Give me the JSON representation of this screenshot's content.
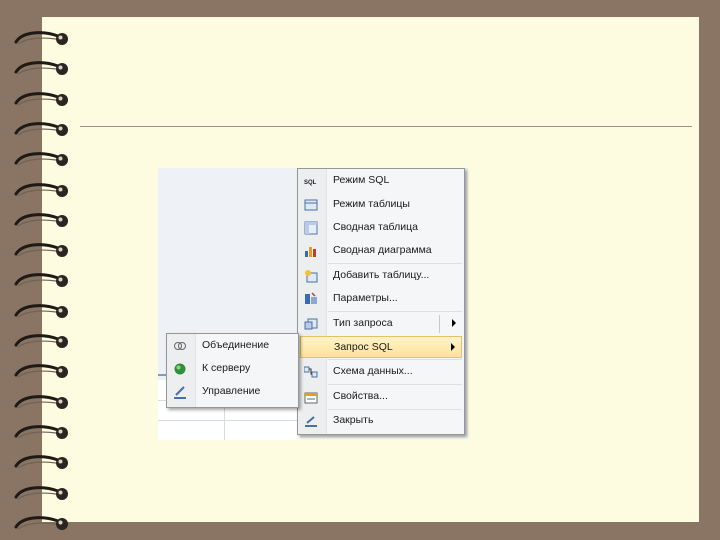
{
  "main_menu": {
    "items": [
      {
        "label": "Режим SQL",
        "icon": "sql-view-icon"
      },
      {
        "label": "Режим таблицы",
        "icon": "datasheet-icon"
      },
      {
        "label": "Сводная таблица",
        "icon": "pivot-table-icon"
      },
      {
        "label": "Сводная диаграмма",
        "icon": "pivot-chart-icon"
      },
      {
        "label": "Добавить таблицу...",
        "icon": "add-table-icon"
      },
      {
        "label": "Параметры...",
        "icon": "parameters-icon"
      },
      {
        "label": "Тип запроса",
        "icon": "query-type-icon"
      },
      {
        "label": "Запрос SQL",
        "icon": "none"
      },
      {
        "label": "Схема данных...",
        "icon": "relationships-icon"
      },
      {
        "label": "Свойства...",
        "icon": "properties-icon"
      },
      {
        "label": "Закрыть",
        "icon": "close-icon"
      }
    ],
    "highlighted": "Запрос SQL"
  },
  "sub_menu": {
    "items": [
      {
        "label": "Объединение",
        "icon": "union-icon"
      },
      {
        "label": "К серверу",
        "icon": "pass-through-icon"
      },
      {
        "label": "Управление",
        "icon": "data-definition-icon"
      }
    ]
  },
  "colors": {
    "page_background": "#8a7463",
    "paper": "#fdfce1",
    "menu_background": "#f5f6f7",
    "highlight": "#fde39a"
  }
}
